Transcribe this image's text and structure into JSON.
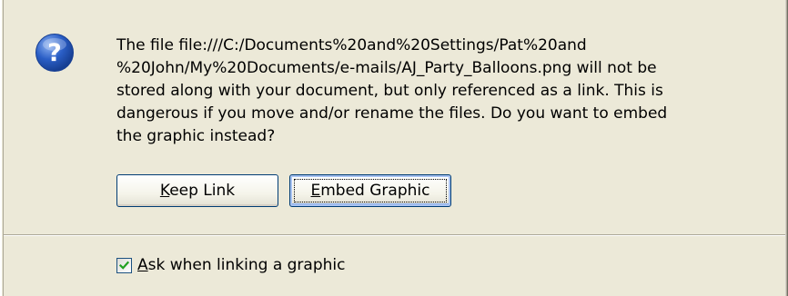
{
  "message": {
    "lines": [
      "The file file:///C:/Documents%20and%20Settings/Pat%20and",
      "%20John/My%20Documents/e-mails/AJ_Party_Balloons.png will not be",
      "stored along with your document, but only referenced as a link. This is",
      "dangerous if you move and/or rename the files. Do you want to embed",
      "the graphic instead?"
    ]
  },
  "buttons": {
    "keep_link": {
      "accel": "K",
      "rest": "eep Link"
    },
    "embed_graphic": {
      "accel": "E",
      "rest": "mbed Graphic"
    }
  },
  "checkbox": {
    "checked": true,
    "label_accel": "A",
    "label_rest": "sk when linking a graphic"
  },
  "icon": {
    "name": "question-icon",
    "glyph": "?"
  },
  "colors": {
    "dialog_bg": "#ece9d8",
    "icon_blue": "#2a5ec6",
    "button_border": "#003c74",
    "check_green": "#21a121"
  }
}
